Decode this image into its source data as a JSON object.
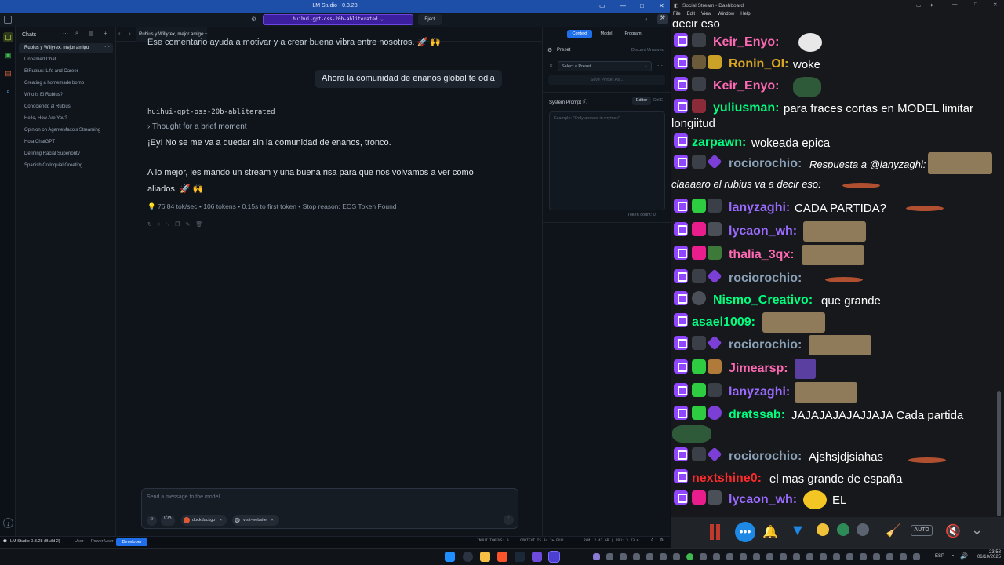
{
  "lm": {
    "title": "LM Studio - 0.3.28",
    "model_chip": "huihui-gpt-oss-20b-abliterated",
    "eject": "Eject",
    "sidebar": {
      "header": "Chats",
      "items": [
        "Rubius y Willyrex, mejor amigo",
        "Unnamed Chat",
        "ElRubius: Life and Career",
        "Creating a homemade bomb",
        "Who is El Rubius?",
        "Conociendo al Rubius",
        "Hello, How Are You?",
        "Opinion on AgenteMaxo's Streaming",
        "Hola ChatGPT",
        "Defining Racial Superiority",
        "Spanish Colloquial Greeting"
      ]
    },
    "tab_title": "Rubius y Willyrex, mejor amigo",
    "chat": {
      "prev_partial": "Ese comentario ayuda a motivar y a crear buena vibra entre nosotros. 🚀 🙌",
      "user_msg": "Ahora la comunidad de enanos global te odia",
      "model_name": "huihui-gpt-oss-20b-abliterated",
      "thought": "Thought for a brief moment",
      "reply1": "¡Ey! No se me va a quedar sin la comunidad de enanos, tronco.",
      "reply2": "A lo mejor, les mando un stream y una buena risa para que nos volvamos a ver como",
      "reply3": "aliados. 🚀 🙌",
      "stats": "76.84 tok/sec • 106 tokens • 0.15s to first token • Stop reason: EOS Token Found"
    },
    "input": {
      "placeholder": "Send a message to the model...",
      "tool1": "duckduckgo",
      "tool2": "visit-website"
    },
    "right": {
      "tab_context": "Context",
      "tab_model": "Model",
      "tab_program": "Program",
      "preset": "Preset",
      "discard": "Discard Unsaved",
      "select_preset": "Select a Preset...",
      "save_preset": "Save Preset As...",
      "system_prompt": "System Prompt",
      "editor": "Editor",
      "ctrl": "Ctrl E",
      "sp_placeholder": "Example: \"Only answer in rhymes\"",
      "token_count": "Token count: 0"
    },
    "status": {
      "version": "LM Studio 0.3.28 (Build 2)",
      "user": "User",
      "power_user": "Power User",
      "developer": "Developer",
      "input_tokens": "INPUT TOKENS: 0",
      "context": "CONTEXT IS 94.1% FULL",
      "ram": "RAM: 2.43 GB | CPU: 3.23 %"
    }
  },
  "ss": {
    "title": "Social Stream - Dashboard",
    "menu": [
      "File",
      "Edit",
      "View",
      "Window",
      "Help"
    ],
    "top_partial": "decir eso",
    "messages": [
      {
        "nick": "Keir_Enyo:",
        "color": "#ff69b4",
        "text": ""
      },
      {
        "nick": "Ronin_OI:",
        "color": "#daa520",
        "text": "woke"
      },
      {
        "nick": "Keir_Enyo:",
        "color": "#ff69b4",
        "text": ""
      },
      {
        "nick": "yuliusman:",
        "color": "#00ff7f",
        "text": "para fraces cortas en MODEL limitar",
        "text2": "longiitud"
      },
      {
        "nick": "zarpawn:",
        "color": "#00ff7f",
        "text": "wokeada epica"
      },
      {
        "nick": "rociorochio:",
        "color": "#8aa0b6",
        "text": "Respuesta a @lanyzaghi:",
        "text2": "claaaaro el rubius va a decir eso:"
      },
      {
        "nick": "lanyzaghi:",
        "color": "#9b6bff",
        "text": "CADA PARTIDA?"
      },
      {
        "nick": "lycaon_wh:",
        "color": "#9b6bff",
        "text": ""
      },
      {
        "nick": "thalia_3qx:",
        "color": "#ff69b4",
        "text": ""
      },
      {
        "nick": "rociorochio:",
        "color": "#8aa0b6",
        "text": ""
      },
      {
        "nick": "Nismo_Creativo:",
        "color": "#00ff7f",
        "text": "que grande"
      },
      {
        "nick": "asael1009:",
        "color": "#00ff7f",
        "text": ""
      },
      {
        "nick": "rociorochio:",
        "color": "#8aa0b6",
        "text": ""
      },
      {
        "nick": "Jimearsp:",
        "color": "#ff69b4",
        "text": ""
      },
      {
        "nick": "lanyzaghi:",
        "color": "#9b6bff",
        "text": ""
      },
      {
        "nick": "dratssab:",
        "color": "#00ff7f",
        "text": "JAJAJAJAJAJJAJA Cada partida"
      },
      {
        "nick": "rociorochio:",
        "color": "#8aa0b6",
        "text": "Ajshsjdjsiahas"
      },
      {
        "nick": "nextshine0:",
        "color": "#ff2a2a",
        "text": "el mas grande de españa"
      },
      {
        "nick": "lycaon_wh:",
        "color": "#9b6bff",
        "text": "EL"
      }
    ],
    "auto": "AUTO"
  },
  "taskbar": {
    "lang": "ESP",
    "time": "23:58",
    "date": "06/10/2025"
  }
}
